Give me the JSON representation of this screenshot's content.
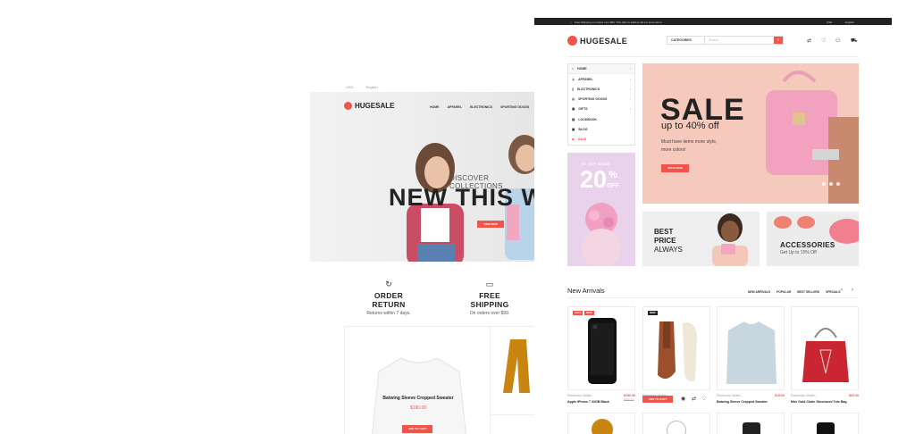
{
  "left_preview": {
    "currency": "USD",
    "language": "English",
    "logo": "HUGESALE",
    "nav": [
      "HOME",
      "APPAREL",
      "ELECTRONICS",
      "SPORTING GOODS"
    ],
    "hero": {
      "kicker": "DISCOVER COLLECTIONS",
      "headline": "NEW THIS W",
      "button": "VIEW NOW"
    },
    "features": [
      {
        "icon": "return-icon",
        "title": "ORDER RETURN",
        "subtitle": "Returns within 7 days."
      },
      {
        "icon": "truck-icon",
        "title": "FREE SHIPPING",
        "subtitle": "On orders over $99."
      }
    ],
    "product": {
      "name": "Batwing Sleeve Cropped Sweater",
      "price": "$190.00",
      "button": "ADD TO CART"
    }
  },
  "right_preview": {
    "topbar": {
      "notice": "Free Shipping on orders over $99. This offer is valid on all our store items.",
      "currency": "USD",
      "language": "English"
    },
    "logo": "HUGESALE",
    "search": {
      "category": "CATEGORIES",
      "placeholder": "Search"
    },
    "header_icons": [
      "compare-icon",
      "heart-icon",
      "user-icon",
      "cart-icon"
    ],
    "sidebar": [
      {
        "icon": "home-icon",
        "label": "HOME"
      },
      {
        "icon": "shirt-icon",
        "label": "APPAREL"
      },
      {
        "icon": "phone-icon",
        "label": "ELECTRONICS"
      },
      {
        "icon": "ball-icon",
        "label": "SPORTING GOODS"
      },
      {
        "icon": "gift-icon",
        "label": "GIFTS"
      },
      {
        "icon": "book-icon",
        "label": "LOOKBOOK"
      },
      {
        "icon": "blog-icon",
        "label": "BLOG"
      },
      {
        "icon": "tag-icon",
        "label": "SALE"
      }
    ],
    "hero": {
      "title": "SALE",
      "subtitle": "up to 40% off",
      "desc1": "Must have items more style,",
      "desc2": "more colors!",
      "button": "SHOP NOW"
    },
    "banner_left": {
      "kicker": "On 100+ Brands",
      "value": "20",
      "pct": "%",
      "off": "OFF"
    },
    "banner_best": {
      "line1": "BEST",
      "line2": "PRICE",
      "line3": "ALWAYS"
    },
    "banner_acc": {
      "title": "ACCESSORIES",
      "subtitle": "Get Up to 15% Off"
    },
    "new_arrivals": {
      "title": "New Arrivals",
      "tabs": [
        "NEW ARRIVALS",
        "POPULAR",
        "BEST SELLERS",
        "SPECIALS"
      ],
      "products": [
        {
          "meta": "Electronics, Mobile...",
          "name": "Apple iPhone 7 32GB Black",
          "price": "$190.00",
          "old": "$200.00",
          "badges": [
            "SALE",
            "NEW"
          ]
        },
        {
          "meta": "Electronics, Mobile...",
          "name": "",
          "price": "",
          "old": "",
          "badges": [
            "NEW"
          ],
          "button": "ADD TO CART"
        },
        {
          "meta": "Electronics, Mobile...",
          "name": "Batwing Sleeve Cropped Sweater",
          "price": "$15.00",
          "old": "",
          "badges": []
        },
        {
          "meta": "Electronics, Mobile...",
          "name": "Mini Gold Chain Structured Tote Bag",
          "price": "$60.00",
          "old": "",
          "badges": []
        }
      ]
    }
  }
}
